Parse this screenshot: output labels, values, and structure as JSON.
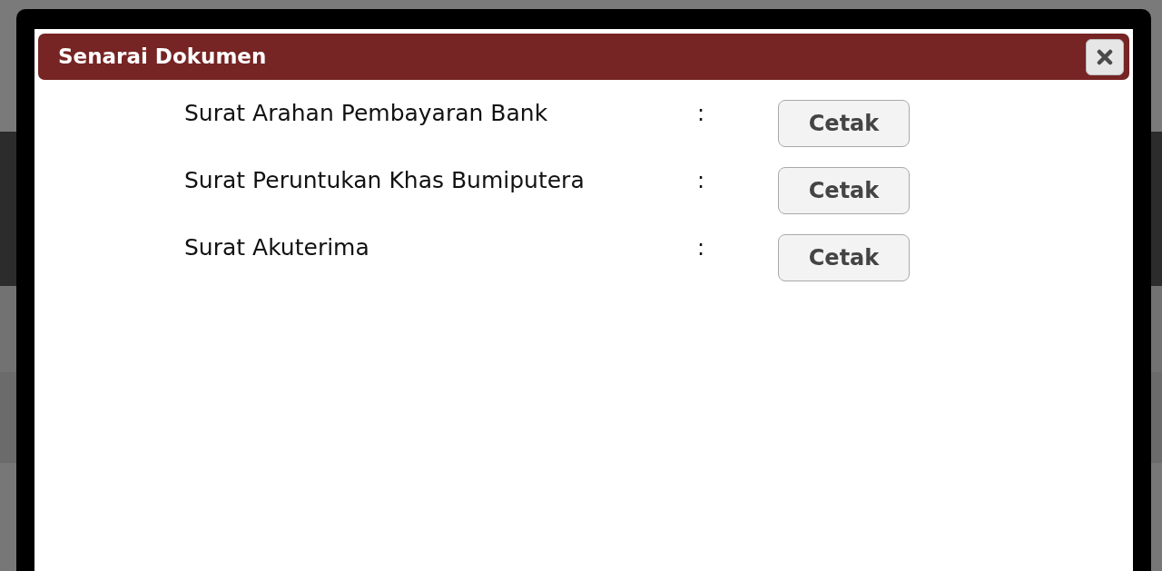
{
  "dialog": {
    "title": "Senarai Dokumen"
  },
  "documents": [
    {
      "label": "Surat Arahan Pembayaran Bank",
      "separator": ":",
      "action": "Cetak"
    },
    {
      "label": "Surat Peruntukan Khas Bumiputera",
      "separator": ":",
      "action": "Cetak"
    },
    {
      "label": "Surat Akuterima",
      "separator": ":",
      "action": "Cetak"
    }
  ]
}
